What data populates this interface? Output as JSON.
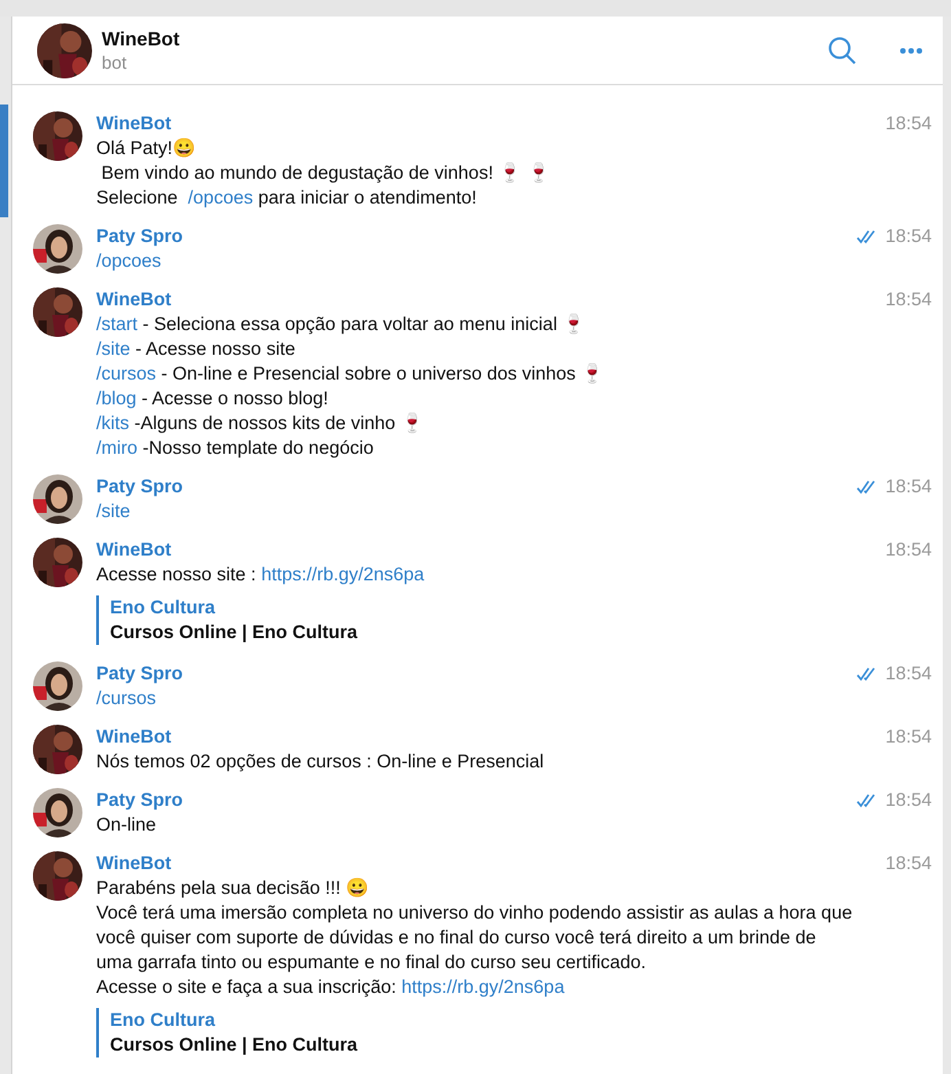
{
  "chat": {
    "title": "WineBot",
    "subtitle": "bot"
  },
  "messages": [
    {
      "sender": "WineBot",
      "kind": "bot",
      "time": "18:54",
      "read": false,
      "selected": true,
      "lines": [
        [
          {
            "text": "Olá Paty!😀",
            "link": false
          }
        ],
        [
          {
            "text": " Bem vindo ao mundo de degustação de vinhos! 🍷 🍷",
            "link": false
          }
        ],
        [
          {
            "text": "Selecione  ",
            "link": false
          },
          {
            "text": "/opcoes",
            "link": true
          },
          {
            "text": " para iniciar o atendimento!",
            "link": false
          }
        ]
      ]
    },
    {
      "sender": "Paty Spro",
      "kind": "user",
      "time": "18:54",
      "read": true,
      "selected": false,
      "lines": [
        [
          {
            "text": "/opcoes",
            "link": true
          }
        ]
      ]
    },
    {
      "sender": "WineBot",
      "kind": "bot",
      "time": "18:54",
      "read": false,
      "selected": false,
      "lines": [
        [
          {
            "text": "/start",
            "link": true
          },
          {
            "text": " - Seleciona essa opção para voltar ao menu inicial 🍷",
            "link": false
          }
        ],
        [
          {
            "text": "/site",
            "link": true
          },
          {
            "text": " - Acesse nosso site",
            "link": false
          }
        ],
        [
          {
            "text": "/cursos",
            "link": true
          },
          {
            "text": " - On-line e Presencial sobre o universo dos vinhos 🍷",
            "link": false
          }
        ],
        [
          {
            "text": "/blog",
            "link": true
          },
          {
            "text": " - Acesse o nosso blog!",
            "link": false
          }
        ],
        [
          {
            "text": "/kits",
            "link": true
          },
          {
            "text": " -Alguns de nossos kits de vinho 🍷",
            "link": false
          }
        ],
        [
          {
            "text": "/miro",
            "link": true
          },
          {
            "text": " -Nosso template do negócio",
            "link": false
          }
        ]
      ]
    },
    {
      "sender": "Paty Spro",
      "kind": "user",
      "time": "18:54",
      "read": true,
      "selected": false,
      "lines": [
        [
          {
            "text": "/site",
            "link": true
          }
        ]
      ]
    },
    {
      "sender": "WineBot",
      "kind": "bot",
      "time": "18:54",
      "read": false,
      "selected": false,
      "lines": [
        [
          {
            "text": "Acesse nosso site : ",
            "link": false
          },
          {
            "text": "https://rb.gy/2ns6pa",
            "link": true
          }
        ]
      ],
      "preview": {
        "site": "Eno Cultura",
        "title": "Cursos Online | Eno Cultura"
      }
    },
    {
      "sender": "Paty Spro",
      "kind": "user",
      "time": "18:54",
      "read": true,
      "selected": false,
      "lines": [
        [
          {
            "text": "/cursos",
            "link": true
          }
        ]
      ]
    },
    {
      "sender": "WineBot",
      "kind": "bot",
      "time": "18:54",
      "read": false,
      "selected": false,
      "lines": [
        [
          {
            "text": "Nós temos 02 opções de cursos : On-line e Presencial",
            "link": false
          }
        ]
      ]
    },
    {
      "sender": "Paty Spro",
      "kind": "user",
      "time": "18:54",
      "read": true,
      "selected": false,
      "lines": [
        [
          {
            "text": "On-line",
            "link": false
          }
        ]
      ]
    },
    {
      "sender": "WineBot",
      "kind": "bot",
      "time": "18:54",
      "read": false,
      "selected": false,
      "lines": [
        [
          {
            "text": "Parabéns pela sua decisão !!! 😀",
            "link": false
          }
        ],
        [
          {
            "text": "Você terá uma imersão completa no universo do vinho podendo assistir as aulas a hora que",
            "link": false
          }
        ],
        [
          {
            "text": "você quiser com suporte de dúvidas e no final do curso você terá direito a um brinde de",
            "link": false
          }
        ],
        [
          {
            "text": "uma garrafa tinto ou espumante e no final do curso seu certificado.",
            "link": false
          }
        ],
        [
          {
            "text": "Acesse o site e faça a sua inscrição: ",
            "link": false
          },
          {
            "text": "https://rb.gy/2ns6pa",
            "link": true
          }
        ]
      ],
      "preview": {
        "site": "Eno Cultura",
        "title": "Cursos Online | Eno Cultura"
      }
    }
  ]
}
